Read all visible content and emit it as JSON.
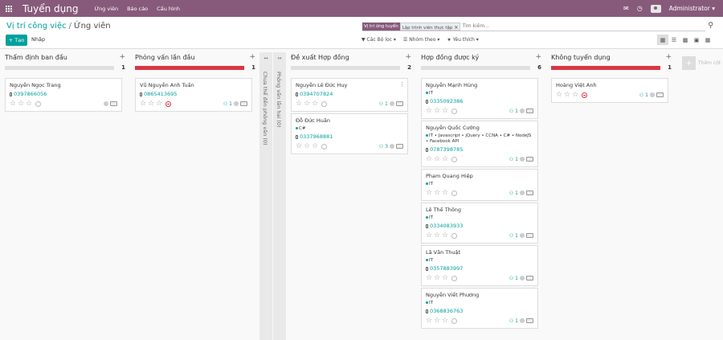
{
  "topbar": {
    "brand": "Tuyển dụng",
    "menu": [
      "Ứng viên",
      "Báo cáo",
      "Cấu hình"
    ],
    "user": "Administrator"
  },
  "breadcrumb": {
    "parent": "Vị trí công việc",
    "current": "Ứng viên"
  },
  "search": {
    "facet_label": "Vị trí ứng tuyển",
    "facet_value": "Lập trình viên thực tập",
    "placeholder": "Tìm kiếm..."
  },
  "toolbar": {
    "create_label": "Tạo",
    "import_label": "Nhập",
    "filters_label": "Các Bộ lọc",
    "group_label": "Nhóm theo",
    "fav_label": "Yêu thích"
  },
  "columns": [
    {
      "title": "Thẩm định ban đầu",
      "count": "1",
      "cards": [
        {
          "name": "Nguyễn Ngọc Trang",
          "phone": "0397866056",
          "tags": "",
          "att": "",
          "activity": "none"
        }
      ]
    },
    {
      "title": "Phỏng vấn lần đầu",
      "count": "1",
      "cards": [
        {
          "name": "Vũ Nguyễn Anh Tuấn",
          "phone": "0865413695",
          "tags": "",
          "att": "1",
          "activity": "overdue"
        }
      ]
    },
    {
      "title": "Đề xuất Hợp đồng",
      "count": "2",
      "cards": [
        {
          "name": "Nguyễn Lê Đức Huy",
          "phone": "0394707824",
          "tags": "",
          "att": "1",
          "activity": "none"
        },
        {
          "name": "Đỗ Đức Huấn",
          "phone": "0337968881",
          "tags": "C#",
          "att": "3",
          "activity": "none"
        }
      ]
    },
    {
      "title": "Hợp đồng được ký",
      "count": "6",
      "cards": [
        {
          "name": "Nguyễn Mạnh Hùng",
          "phone": "0335092386",
          "tags": "IT",
          "att": "1",
          "activity": "none"
        },
        {
          "name": "Nguyễn Quốc Cường",
          "phone": "0787398785",
          "tags": "IT • Javascript • jQuery • CCNA • C# • NodeJS • Facebook API",
          "att": "1",
          "activity": "none"
        },
        {
          "name": "Phạm Quang Hiệp",
          "phone": "",
          "tags": "IT",
          "att": "1",
          "activity": "none"
        },
        {
          "name": "Lê Thế Thông",
          "phone": "0334083933",
          "tags": "IT",
          "att": "1",
          "activity": "none"
        },
        {
          "name": "Lã Văn Thuật",
          "phone": "0357883997",
          "tags": "IT",
          "att": "1",
          "activity": "none"
        },
        {
          "name": "Nguyễn Viết Phương",
          "phone": "0368836763",
          "tags": "IT",
          "att": "1",
          "activity": "none"
        }
      ]
    },
    {
      "title": "Không tuyển dụng",
      "count": "1",
      "cards": [
        {
          "name": "Hoàng Việt Anh",
          "phone": "",
          "tags": "",
          "att": "1",
          "activity": "overdue"
        }
      ]
    }
  ],
  "folded": [
    {
      "label": "Chưa thể đến phỏng vấn (0)"
    },
    {
      "label": "Phỏng vấn lần hai (0)"
    }
  ],
  "add_column": {
    "label": "Thêm cột"
  },
  "colors": {
    "brand": "#875a7b",
    "accent": "#00a09d",
    "danger": "#dc3545"
  }
}
